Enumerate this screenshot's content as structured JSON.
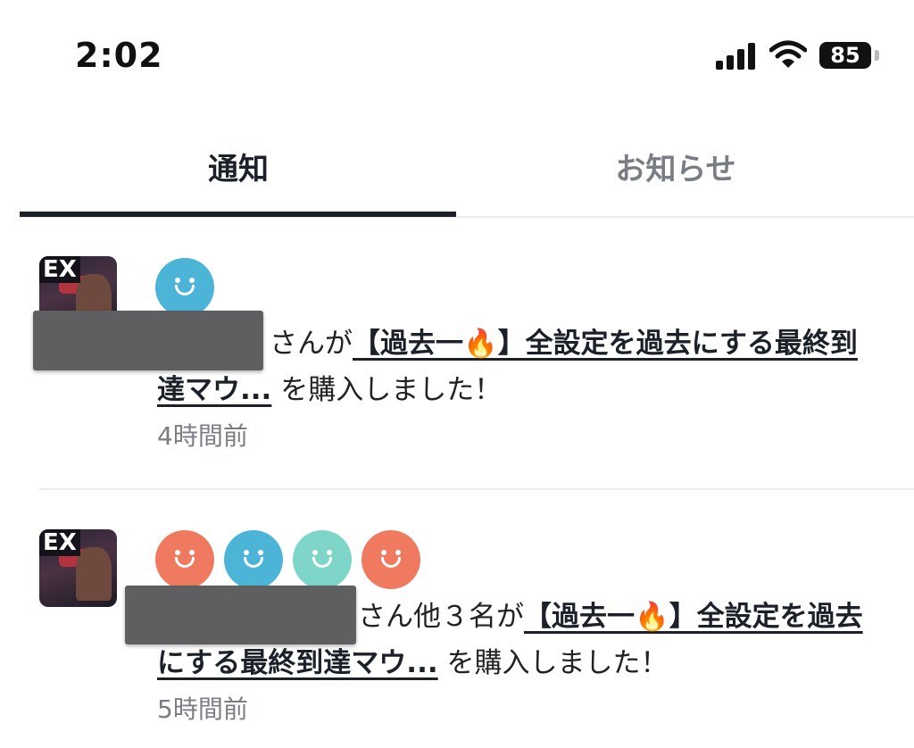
{
  "status_bar": {
    "time": "2:02",
    "battery": "85"
  },
  "tabs": [
    {
      "label": "通知",
      "active": true
    },
    {
      "label": "お知らせ",
      "active": false
    }
  ],
  "notifications": [
    {
      "thumb_text": "EX",
      "avatar_colors": [
        "#4cb4d6"
      ],
      "suffix": "さんが",
      "link": "【過去一🔥】全設定を過去にする最終到達マウ...",
      "action": " を購入しました！",
      "time": "4時間前"
    },
    {
      "thumb_text": "EX",
      "avatar_colors": [
        "#f07a60",
        "#4cb4d6",
        "#7dd6c8",
        "#f07a60"
      ],
      "suffix": "さん他３名が",
      "link": "【過去一🔥】全設定を過去にする最終到達マウ...",
      "action": " を購入しました！",
      "time": "5時間前"
    }
  ]
}
